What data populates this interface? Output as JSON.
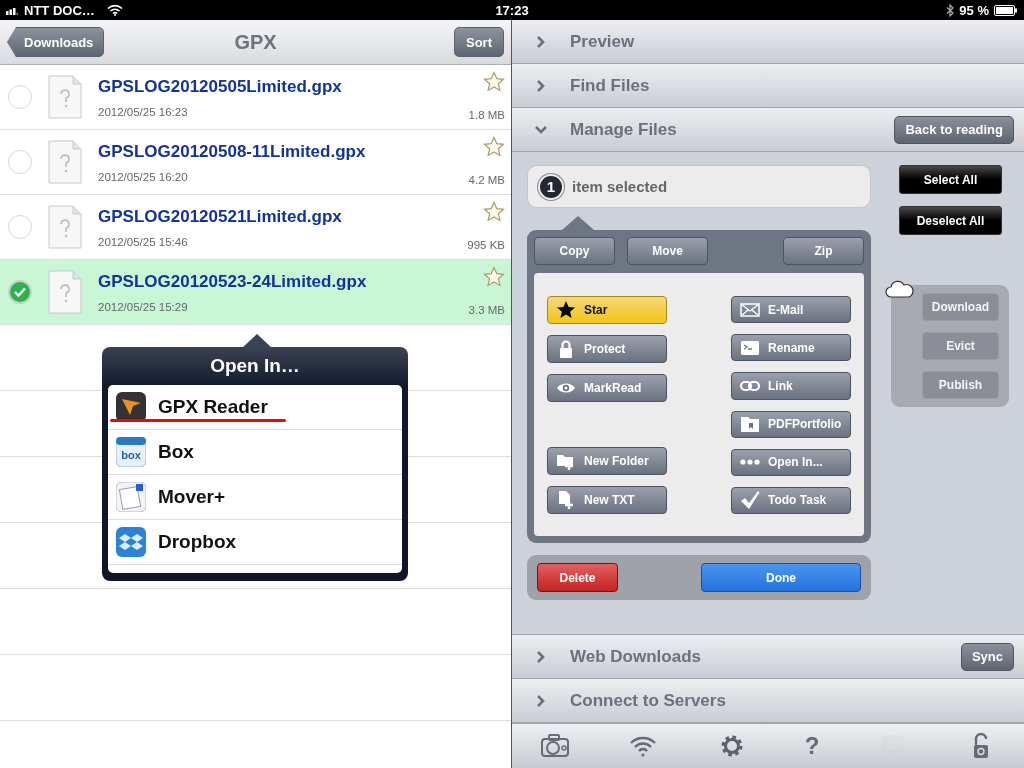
{
  "status_bar": {
    "carrier": "NTT DOC…",
    "time": "17:23",
    "battery": "95 %"
  },
  "nav_bar": {
    "back": "Downloads",
    "title": "GPX",
    "action": "Sort"
  },
  "files": [
    {
      "name": "GPSLOG20120505Limited.gpx",
      "date": "2012/05/25 16:23",
      "size": "1.8 MB",
      "selected": false
    },
    {
      "name": "GPSLOG20120508-11Limited.gpx",
      "date": "2012/05/25 16:20",
      "size": "4.2 MB",
      "selected": false
    },
    {
      "name": "GPSLOG20120521Limited.gpx",
      "date": "2012/05/25 15:46",
      "size": "995 KB",
      "selected": false
    },
    {
      "name": "GPSLOG20120523-24Limited.gpx",
      "date": "2012/05/25 15:29",
      "size": "3.3 MB",
      "selected": true
    }
  ],
  "open_in": {
    "title": "Open In…",
    "apps": [
      {
        "name": "GPX Reader",
        "kind": "gpx",
        "underlined": true
      },
      {
        "name": "Box",
        "kind": "box",
        "underlined": false
      },
      {
        "name": "Mover+",
        "kind": "mover",
        "underlined": false
      },
      {
        "name": "Dropbox",
        "kind": "dropbox",
        "underlined": false
      }
    ]
  },
  "sections": [
    {
      "title": "Preview",
      "expanded": false
    },
    {
      "title": "Find Files",
      "expanded": false
    },
    {
      "title": "Manage Files",
      "expanded": true,
      "button": "Back to reading"
    },
    {
      "title": "Web Downloads",
      "expanded": false,
      "button": "Sync"
    },
    {
      "title": "Connect to Servers",
      "expanded": false
    }
  ],
  "manage": {
    "count": "1",
    "label": "item selected",
    "top_buttons": [
      "Copy",
      "Move",
      "Zip"
    ],
    "left_groups": [
      [
        {
          "label": "Star",
          "kind": "star",
          "active": true
        },
        {
          "label": "Protect",
          "kind": "lock",
          "active": false
        },
        {
          "label": "MarkRead",
          "kind": "eye",
          "active": false
        }
      ],
      [
        {
          "label": "New Folder",
          "kind": "folder-plus",
          "active": false
        },
        {
          "label": "New TXT",
          "kind": "file-plus",
          "active": false
        }
      ]
    ],
    "right_actions": [
      {
        "label": "E-Mail",
        "kind": "envelope",
        "active": false
      },
      {
        "label": "Rename",
        "kind": "terminal",
        "active": false
      },
      {
        "label": "Link",
        "kind": "link",
        "active": false
      },
      {
        "label": "PDFPortfolio",
        "kind": "folder",
        "active": false
      },
      {
        "label": "Open In...",
        "kind": "dots",
        "active": false
      },
      {
        "label": "Todo Task",
        "kind": "check",
        "active": false
      }
    ],
    "select_buttons": [
      "Select All",
      "Deselect All"
    ],
    "cloud_buttons": [
      {
        "label": "Download",
        "disabled": true
      },
      {
        "label": "Evict",
        "disabled": true
      },
      {
        "label": "Publish",
        "disabled": true
      }
    ],
    "delete": "Delete",
    "done": "Done"
  },
  "toolbar": [
    {
      "kind": "camera",
      "disabled": false
    },
    {
      "kind": "wifi",
      "disabled": false
    },
    {
      "kind": "gear",
      "disabled": false
    },
    {
      "kind": "help",
      "glyph": "?",
      "disabled": false
    },
    {
      "kind": "monitor",
      "disabled": true
    },
    {
      "kind": "lock",
      "disabled": false
    }
  ]
}
